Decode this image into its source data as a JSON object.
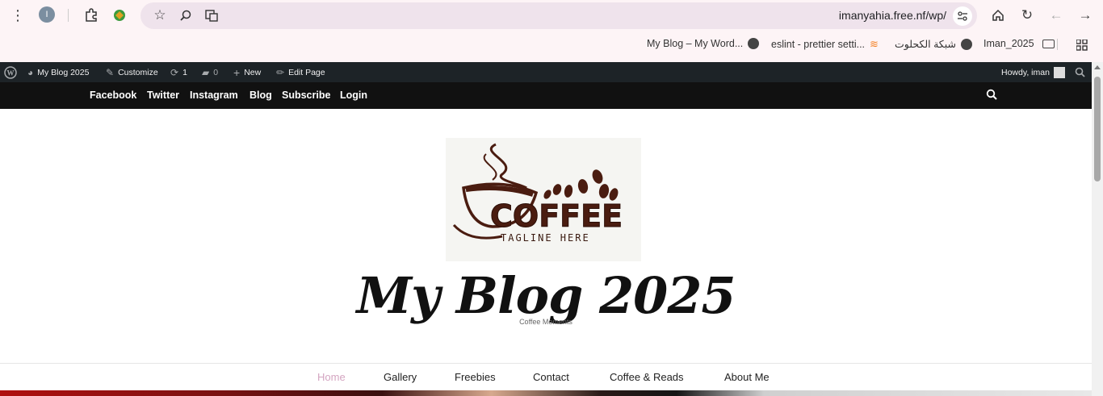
{
  "browser": {
    "url": "imanyahia.free.nf/wp/",
    "profile_initial": "I",
    "bookmarks": [
      {
        "label": "My Blog – My Word..."
      },
      {
        "label": "eslint - prettier setti..."
      },
      {
        "label": "شبكة الكحلوت"
      },
      {
        "label": "Iman_2025"
      }
    ]
  },
  "wp_admin_bar": {
    "site_name": "My Blog 2025",
    "customize": "Customize",
    "updates_count": "1",
    "comments_count": "0",
    "new": "New",
    "edit_page": "Edit Page",
    "howdy": "Howdy, iman"
  },
  "top_nav": {
    "items": [
      "Facebook",
      "Twitter",
      "Instagram",
      "Blog",
      "Subscribe",
      "Login"
    ]
  },
  "logo": {
    "word": "COFFEE",
    "tagline": "TAGLINE HERE"
  },
  "site": {
    "title": "My Blog 2025",
    "tagline": "Coffee Moments"
  },
  "main_nav": {
    "items": [
      "Home",
      "Gallery",
      "Freebies",
      "Contact",
      "Coffee & Reads",
      "About Me"
    ],
    "active": "Home"
  },
  "colors": {
    "admin_bar": "#1d2327",
    "top_nav": "#111111",
    "active_menu": "#d4a5c1",
    "coffee_brown": "#4a1c10"
  }
}
